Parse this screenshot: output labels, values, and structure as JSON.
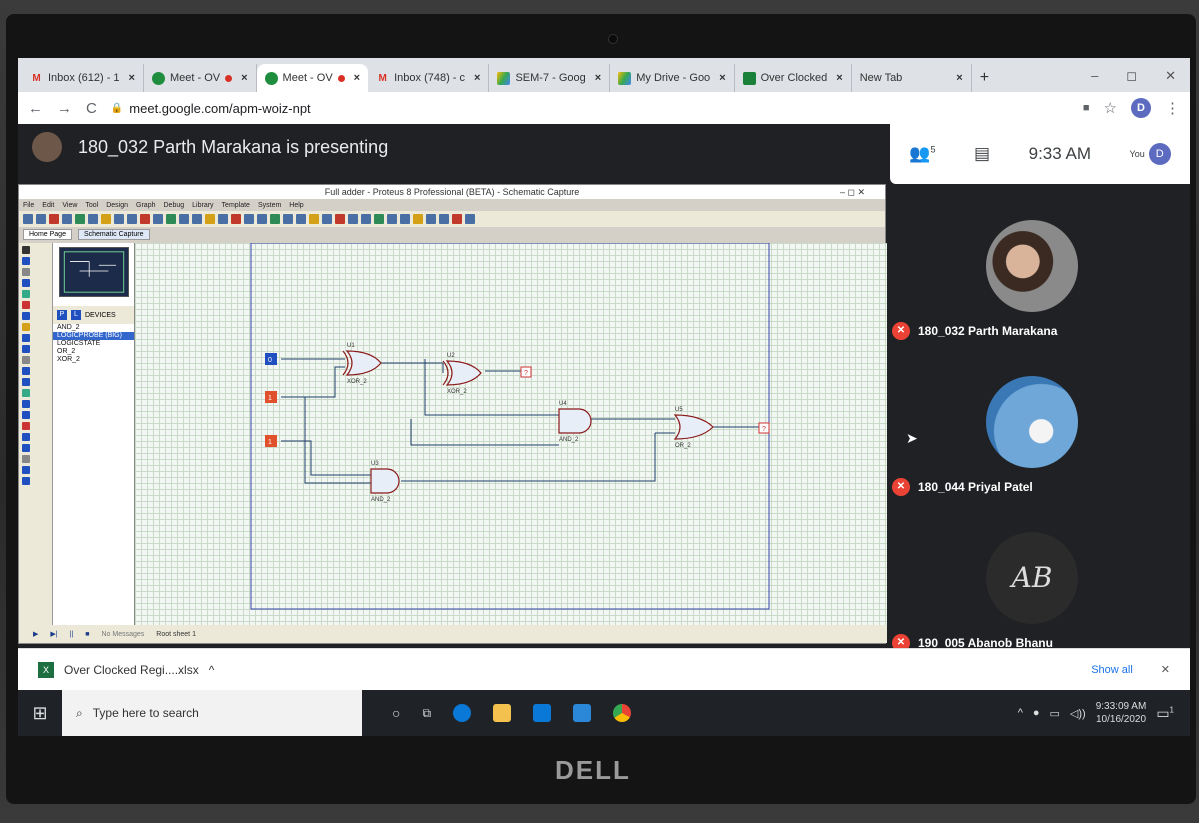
{
  "browser": {
    "tabs": [
      {
        "label": "Inbox (612) - 1",
        "icon": "gmail-icon"
      },
      {
        "label": "Meet - OV",
        "icon": "meet-icon",
        "recording": true
      },
      {
        "label": "Meet - OV",
        "icon": "meet-icon",
        "recording": true,
        "active": true
      },
      {
        "label": "Inbox (748) - c",
        "icon": "gmail-icon"
      },
      {
        "label": "SEM-7 - Goog",
        "icon": "drive-icon"
      },
      {
        "label": "My Drive - Goo",
        "icon": "drive-icon"
      },
      {
        "label": "Over Clocked",
        "icon": "sheets-icon"
      },
      {
        "label": "New Tab",
        "icon": ""
      }
    ],
    "url": "meet.google.com/apm-woiz-npt",
    "profile_initial": "D"
  },
  "meet": {
    "presenting_text": "180_032 Parth Marakana is presenting",
    "participants_count": "5",
    "time": "9:33 AM",
    "you_label": "You",
    "you_initial": "D",
    "participants": [
      {
        "name": "180_032 Parth Marakana"
      },
      {
        "name": "180_044 Priyal Patel"
      },
      {
        "name": "190_005 Abanob Bhanu",
        "avatar_text": "AB"
      }
    ]
  },
  "proteus": {
    "title": "Full adder - Proteus 8 Professional (BETA) - Schematic Capture",
    "menu": [
      "File",
      "Edit",
      "View",
      "Tool",
      "Design",
      "Graph",
      "Debug",
      "Library",
      "Template",
      "System",
      "Help"
    ],
    "tabs": [
      "Home Page",
      "Schematic Capture"
    ],
    "devices_label": "DEVICES",
    "devices": [
      "AND_2",
      "LOGICPROBE (BIG)",
      "LOGICSTATE",
      "OR_2",
      "XOR_2"
    ],
    "selected_device": 1,
    "status_messages": "No Messages",
    "status_sheet": "Root sheet 1",
    "components": {
      "u1": "U1",
      "u2": "U2",
      "u3": "U3",
      "u4": "U4",
      "u5": "U5",
      "xor": "XOR_2",
      "and": "AND_2",
      "or": "OR_2",
      "probe": "?",
      "in_a": "0",
      "in_b": "1",
      "in_c": "1"
    }
  },
  "downloads": {
    "file": "Over Clocked Regi....xlsx",
    "show_all": "Show all"
  },
  "taskbar": {
    "search_placeholder": "Type here to search",
    "time": "9:33:09 AM",
    "date": "10/16/2020",
    "notification_count": "1"
  },
  "device_logo": "DELL"
}
